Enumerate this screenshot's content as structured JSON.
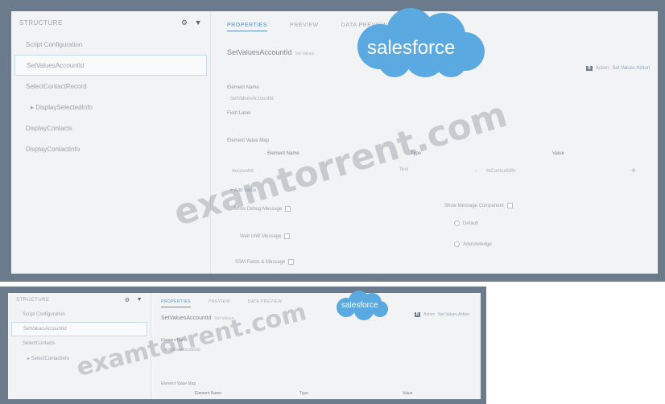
{
  "top": {
    "sidebar": {
      "header": "STRUCTURE",
      "items": [
        {
          "label": "Script Configuration"
        },
        {
          "label": "SetValuesAccountId"
        },
        {
          "label": "SelectContactRecord"
        },
        {
          "label": "▸ DisplaySelectedInfo"
        },
        {
          "label": "DisplayContacts"
        },
        {
          "label": "DisplayContactInfo"
        }
      ]
    },
    "tabs": [
      {
        "label": "PROPERTIES"
      },
      {
        "label": "PREVIEW"
      },
      {
        "label": "DATA PREVIEW"
      }
    ],
    "component": {
      "title": "SetValuesAccountId",
      "subtitle": "Set Values"
    },
    "actions": {
      "bold_label": "B",
      "label": "Action",
      "link": "Set Values Action"
    },
    "fields": {
      "element_name_label": "Element Name",
      "element_name_value": "SetValuesAccountId",
      "field_label_label": "Field Label",
      "element_value_map_label": "Element Value Map"
    },
    "columns": {
      "element_name": "Element Name",
      "type": "Type",
      "value": "Value"
    },
    "row": {
      "name": "AccountId",
      "type": "Text",
      "value": "%ContextId%"
    },
    "add_value": "+ Add Value",
    "checkboxes": {
      "show_debug": "Show Debug Message",
      "wait_until": "Wait Until Message",
      "remote_message": "Remote Message",
      "ssm_fields": "SSM Fields & Message"
    },
    "show_message_label": "Show Message Component",
    "radios": [
      "Default",
      "Acknowledge"
    ]
  },
  "bottom": {
    "sidebar": {
      "header": "STRUCTURE",
      "items": [
        {
          "label": "Script Configuration"
        },
        {
          "label": "SetValuesAccountId"
        },
        {
          "label": "SelectContacts"
        },
        {
          "label": "▸ SelectContactInfo"
        }
      ]
    },
    "tabs": [
      {
        "label": "PROPERTIES"
      },
      {
        "label": "PREVIEW"
      },
      {
        "label": "DATA PREVIEW"
      }
    ],
    "component": {
      "title": "SetValuesAccountId",
      "subtitle": "Set Values"
    },
    "actions": {
      "bold_label": "B",
      "label": "Action",
      "link": "Set Values Action"
    },
    "fields": {
      "element_name_label": "Element Name",
      "element_name_value": "SetValuesAccountId",
      "element_value_map_label": "Element Value Map"
    },
    "columns": {
      "element_name": "Element Name",
      "type": "Type",
      "value": "Value"
    }
  },
  "logo": {
    "text": "salesforce",
    "color": "#5aa9e1"
  },
  "watermark": {
    "text": "examtorrent.com"
  },
  "colors": {
    "frame": "#6b7b8c",
    "panel": "#f2f3f4",
    "accent": "#5b8dc4"
  }
}
